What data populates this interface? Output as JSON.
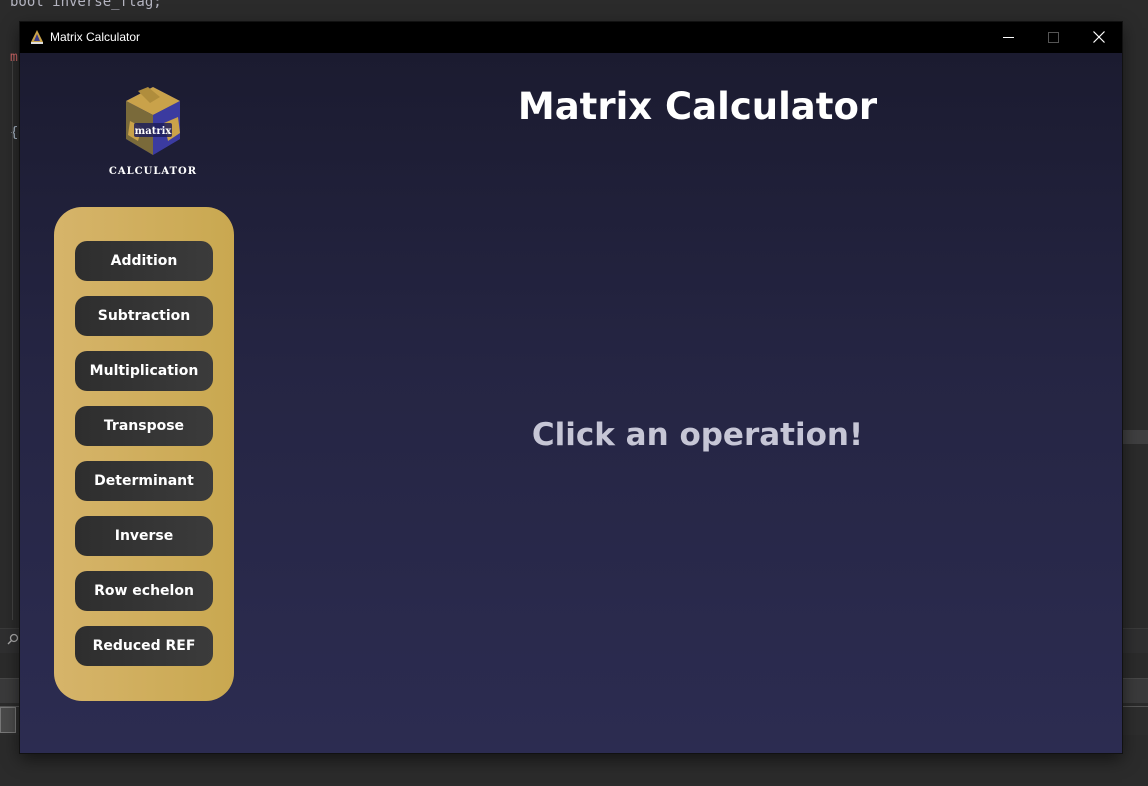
{
  "background": {
    "code_line": "bool inverse_flag;",
    "m_char": "m",
    "brace": "{"
  },
  "window": {
    "title": "Matrix Calculator",
    "icon": "app-logo-icon",
    "controls": {
      "minimize": "minimize-icon",
      "maximize": "maximize-icon",
      "close": "close-icon"
    }
  },
  "logo": {
    "center_text": "matrix",
    "caption": "CALCULATOR"
  },
  "header": {
    "title": "Matrix Calculator"
  },
  "operations": [
    {
      "label": "Addition"
    },
    {
      "label": "Subtraction"
    },
    {
      "label": "Multiplication"
    },
    {
      "label": "Transpose"
    },
    {
      "label": "Determinant"
    },
    {
      "label": "Inverse"
    },
    {
      "label": "Row echelon"
    },
    {
      "label": "Reduced REF"
    }
  ],
  "main": {
    "prompt": "Click an operation!"
  },
  "colors": {
    "sidebar": "#cfae5c",
    "button": "#333333",
    "background_top": "#1b1b30",
    "background_bottom": "#2c2c51"
  }
}
